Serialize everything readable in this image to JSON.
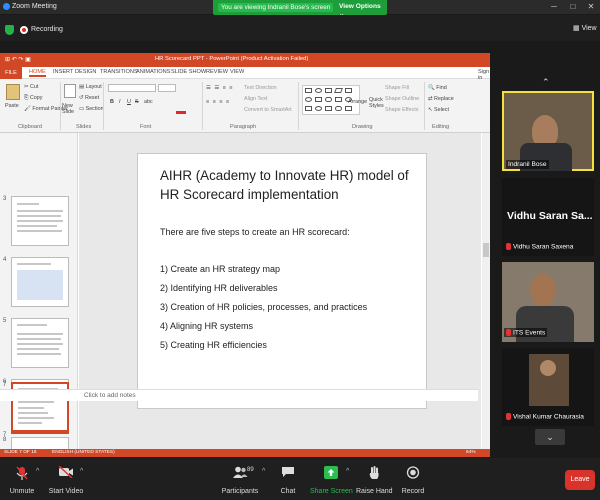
{
  "zoom": {
    "window_title": "Zoom Meeting",
    "share_banner": "You are viewing Indranil Bose's screen",
    "view_options": "View Options ⌄",
    "recording": "Recording",
    "view_label": "View",
    "window_controls": [
      "─",
      "□",
      "✕"
    ]
  },
  "ppt": {
    "title": "HR Scorecard PPT  -  PowerPoint (Product Activation Failed)",
    "quick_access": "⊞ ↶ ↷ ▣",
    "tabs": [
      "FILE",
      "HOME",
      "INSERT",
      "DESIGN",
      "TRANSITIONS",
      "ANIMATIONS",
      "SLIDE SHOW",
      "REVIEW",
      "VIEW"
    ],
    "sign_in": "Sign in",
    "ribbon": {
      "clipboard": {
        "paste": "Paste",
        "cut": "Cut",
        "copy": "Copy",
        "format_painter": "Format Painter",
        "group": "Clipboard"
      },
      "slides": {
        "new_slide": "New Slide",
        "layout": "Layout",
        "reset": "Reset",
        "section": "Section",
        "group": "Slides"
      },
      "font": {
        "group": "Font",
        "bold": "B",
        "italic": "I",
        "underline": "U",
        "strike": "S",
        "shadow": "abc"
      },
      "paragraph": {
        "group": "Paragraph",
        "text_direction": "Text Direction",
        "align_text": "Align Text",
        "smartart": "Convert to SmartArt"
      },
      "drawing": {
        "group": "Drawing",
        "arrange": "Arrange",
        "quick_styles": "Quick Styles",
        "shape_fill": "Shape Fill",
        "shape_outline": "Shape Outline",
        "shape_effects": "Shape Effects"
      },
      "editing": {
        "group": "Editing",
        "find": "Find",
        "replace": "Replace",
        "select": "Select"
      }
    },
    "thumb_numbers": [
      "3",
      "4",
      "5",
      "6",
      "7",
      "8"
    ],
    "slide": {
      "title": "AIHR (Academy to Innovate HR) model of HR Scorecard implementation",
      "intro": "There are five steps to create an HR scorecard:",
      "steps": [
        "1) Create an HR strategy map",
        "2) Identifying HR deliverables",
        "3) Creation of HR policies, processes, and practices",
        "4) Aligning HR systems",
        "5) Creating HR efficiencies"
      ]
    },
    "notes_placeholder": "Click to add notes",
    "status_left": "SLIDE 7 OF 16",
    "status_lang": "ENGLISH (UNITED STATES)",
    "status_zoom": "64%"
  },
  "participants": {
    "tiles": [
      {
        "name": "Indranil Bose",
        "muted": false
      },
      {
        "name": "Vidhu Saran Saxena",
        "muted": true,
        "big_label": "Vidhu Saran Sa..."
      },
      {
        "name": "ITS Events",
        "muted": true
      },
      {
        "name": "Vishal Kumar Chaurasia",
        "muted": true
      }
    ],
    "up_chevron": "⌃",
    "down_chevron": "⌄"
  },
  "toolbar": {
    "unmute": "Unmute",
    "start_video": "Start Video",
    "participants": "Participants",
    "participant_count": "89",
    "chat": "Chat",
    "share_screen": "Share Screen",
    "raise_hand": "Raise Hand",
    "record": "Record",
    "leave": "Leave",
    "caret": "^"
  },
  "colors": {
    "ppt_accent": "#d24726",
    "zoom_green": "#1d9e3a",
    "leave_red": "#d9342b",
    "share_green": "#2bbd4e"
  }
}
